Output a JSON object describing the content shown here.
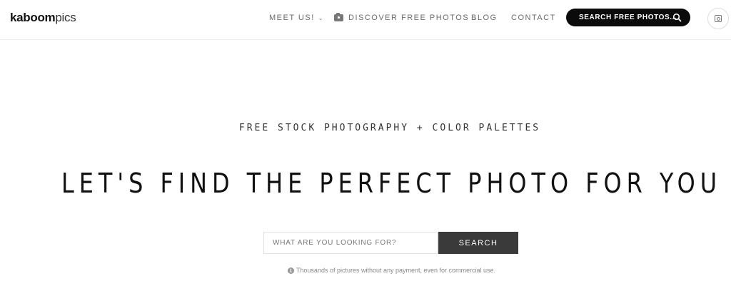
{
  "logo": {
    "bold": "kaboom",
    "light": "pics"
  },
  "nav": {
    "meet_us": "MEET US!",
    "discover": "DISCOVER FREE PHOTOS",
    "blog": "BLOG",
    "contact": "CONTACT",
    "search_pill": "SEARCH FREE PHOTOS..."
  },
  "icons": {
    "camera": "camera-icon",
    "chevron": "chevron-down-icon",
    "search": "search-icon",
    "instagram": "instagram-icon",
    "info": "info-icon"
  },
  "hero": {
    "tagline": "FREE STOCK PHOTOGRAPHY + COLOR PALETTES",
    "headline": "LET'S FIND THE PERFECT PHOTO FOR YOU"
  },
  "search": {
    "placeholder": "WHAT ARE YOU LOOKING FOR?",
    "value": "",
    "button": "SEARCH"
  },
  "note": "Thousands of pictures without any payment, even for commercial use.",
  "colors": {
    "pill_bg": "#0b0b0b",
    "button_bg": "#3a3a3a",
    "nav_text": "#6b6b6b"
  }
}
